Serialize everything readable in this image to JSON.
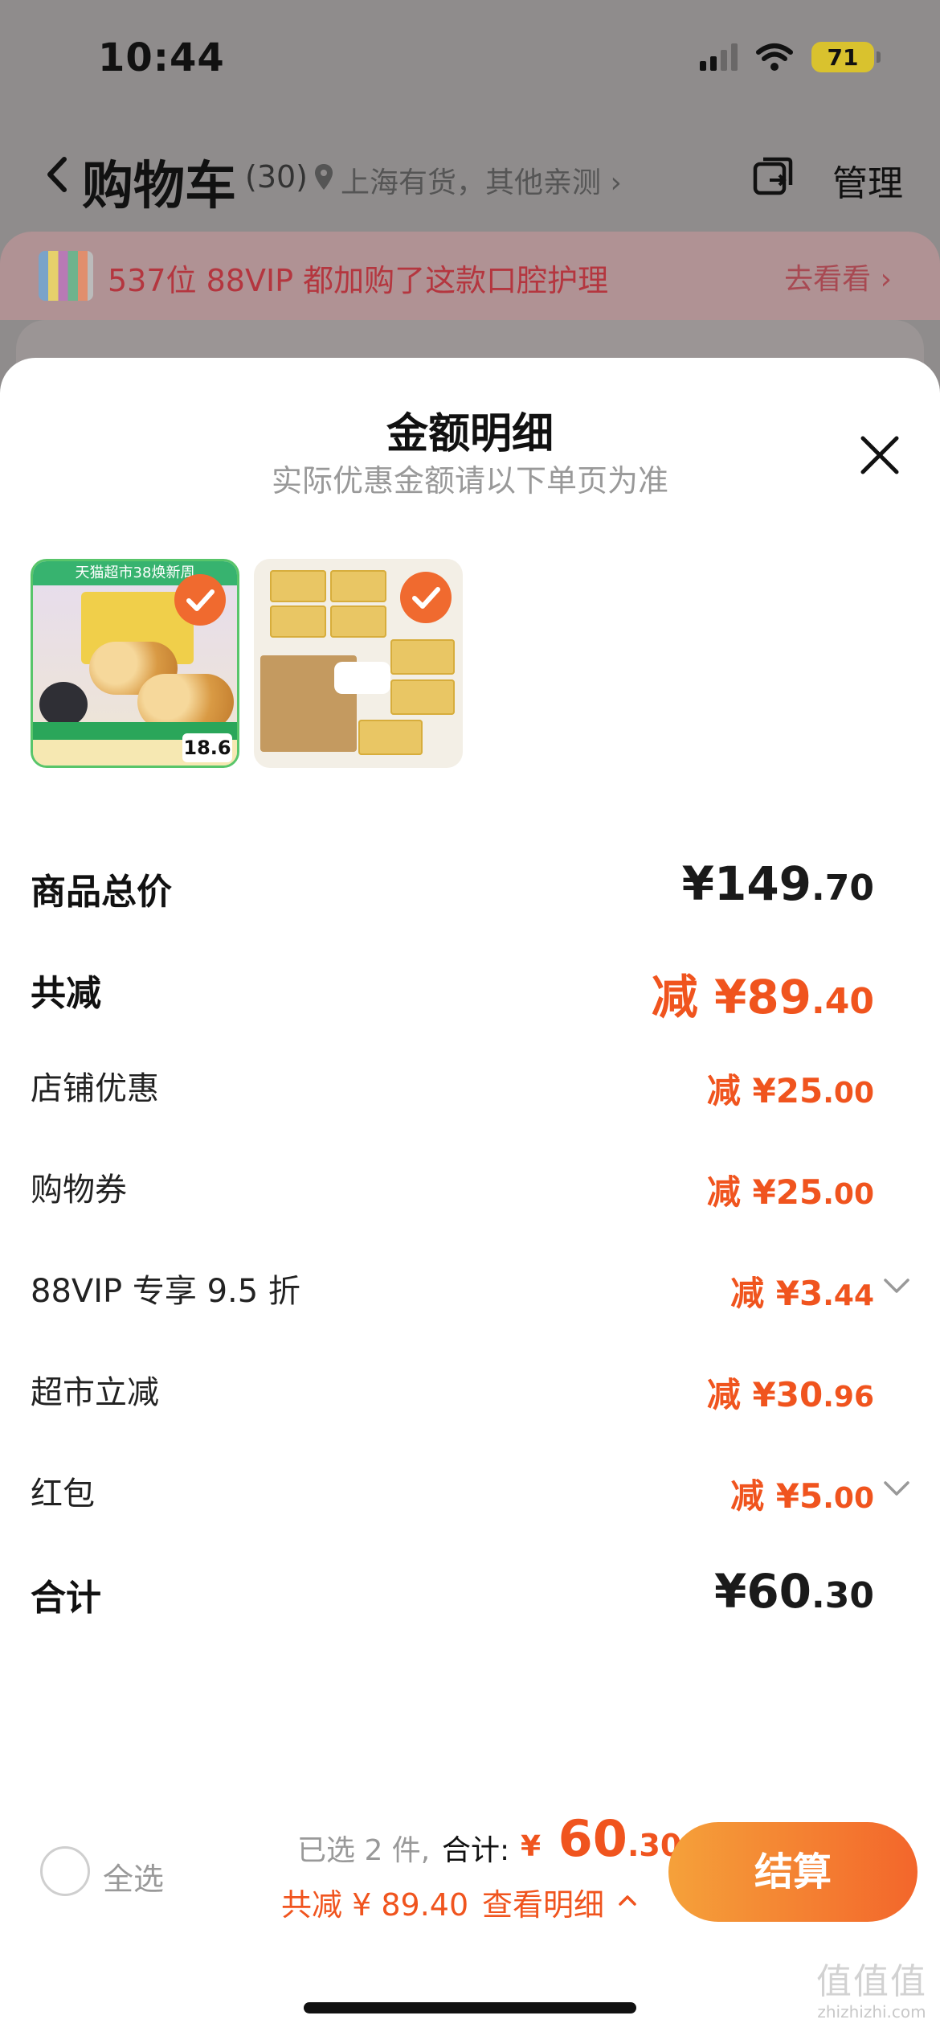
{
  "status": {
    "time": "10:44",
    "battery": "71"
  },
  "nav": {
    "title": "购物车",
    "count": "(30)",
    "location": "上海有货，其他亲测 ›",
    "manage": "管理"
  },
  "promo": {
    "text": "537位 88VIP 都加购了这款口腔护理",
    "link": "去看看 ›"
  },
  "sheet": {
    "title": "金额明细",
    "subtitle": "实际优惠金额请以下单页为准",
    "products": [
      {
        "header": "天猫超市38焕新周",
        "price": "18.6",
        "selected": true
      },
      {
        "selected": true
      }
    ],
    "rows": {
      "subtotal": {
        "label": "商品总价",
        "currency": "¥",
        "int": "149",
        "dec": ".70"
      },
      "discount_total": {
        "label": "共减",
        "prefix": "减 ¥",
        "int": "89",
        "dec": ".40"
      },
      "store": {
        "label": "店铺优惠",
        "prefix": "减 ¥",
        "int": "25",
        "dec": ".00"
      },
      "coupon": {
        "label": "购物券",
        "prefix": "减 ¥",
        "int": "25",
        "dec": ".00"
      },
      "vip": {
        "label": "88VIP 专享 9.5 折",
        "prefix": "减 ¥",
        "int": "3",
        "dec": ".44"
      },
      "market": {
        "label": "超市立减",
        "prefix": "减 ¥",
        "int": "30",
        "dec": ".96"
      },
      "redpacket": {
        "label": "红包",
        "prefix": "减 ¥",
        "int": "5",
        "dec": ".00"
      },
      "total": {
        "label": "合计",
        "currency": "¥",
        "int": "60",
        "dec": ".30"
      }
    }
  },
  "footer": {
    "select_all": "全选",
    "selected_info": "已选 2 件,",
    "total_label": "合计:",
    "total_currency": "¥",
    "total_int": "60",
    "total_dec": ".30",
    "saving": "共减 ¥ 89.40",
    "detail_link": "查看明细",
    "checkout": "结算"
  },
  "watermark": {
    "logo": "值值值",
    "url": "zhizhizhi.com"
  },
  "colors": {
    "accent": "#f0541e",
    "checkout_from": "#f5a13a",
    "checkout_to": "#f3662b",
    "overlay": "#8f8c8c"
  }
}
